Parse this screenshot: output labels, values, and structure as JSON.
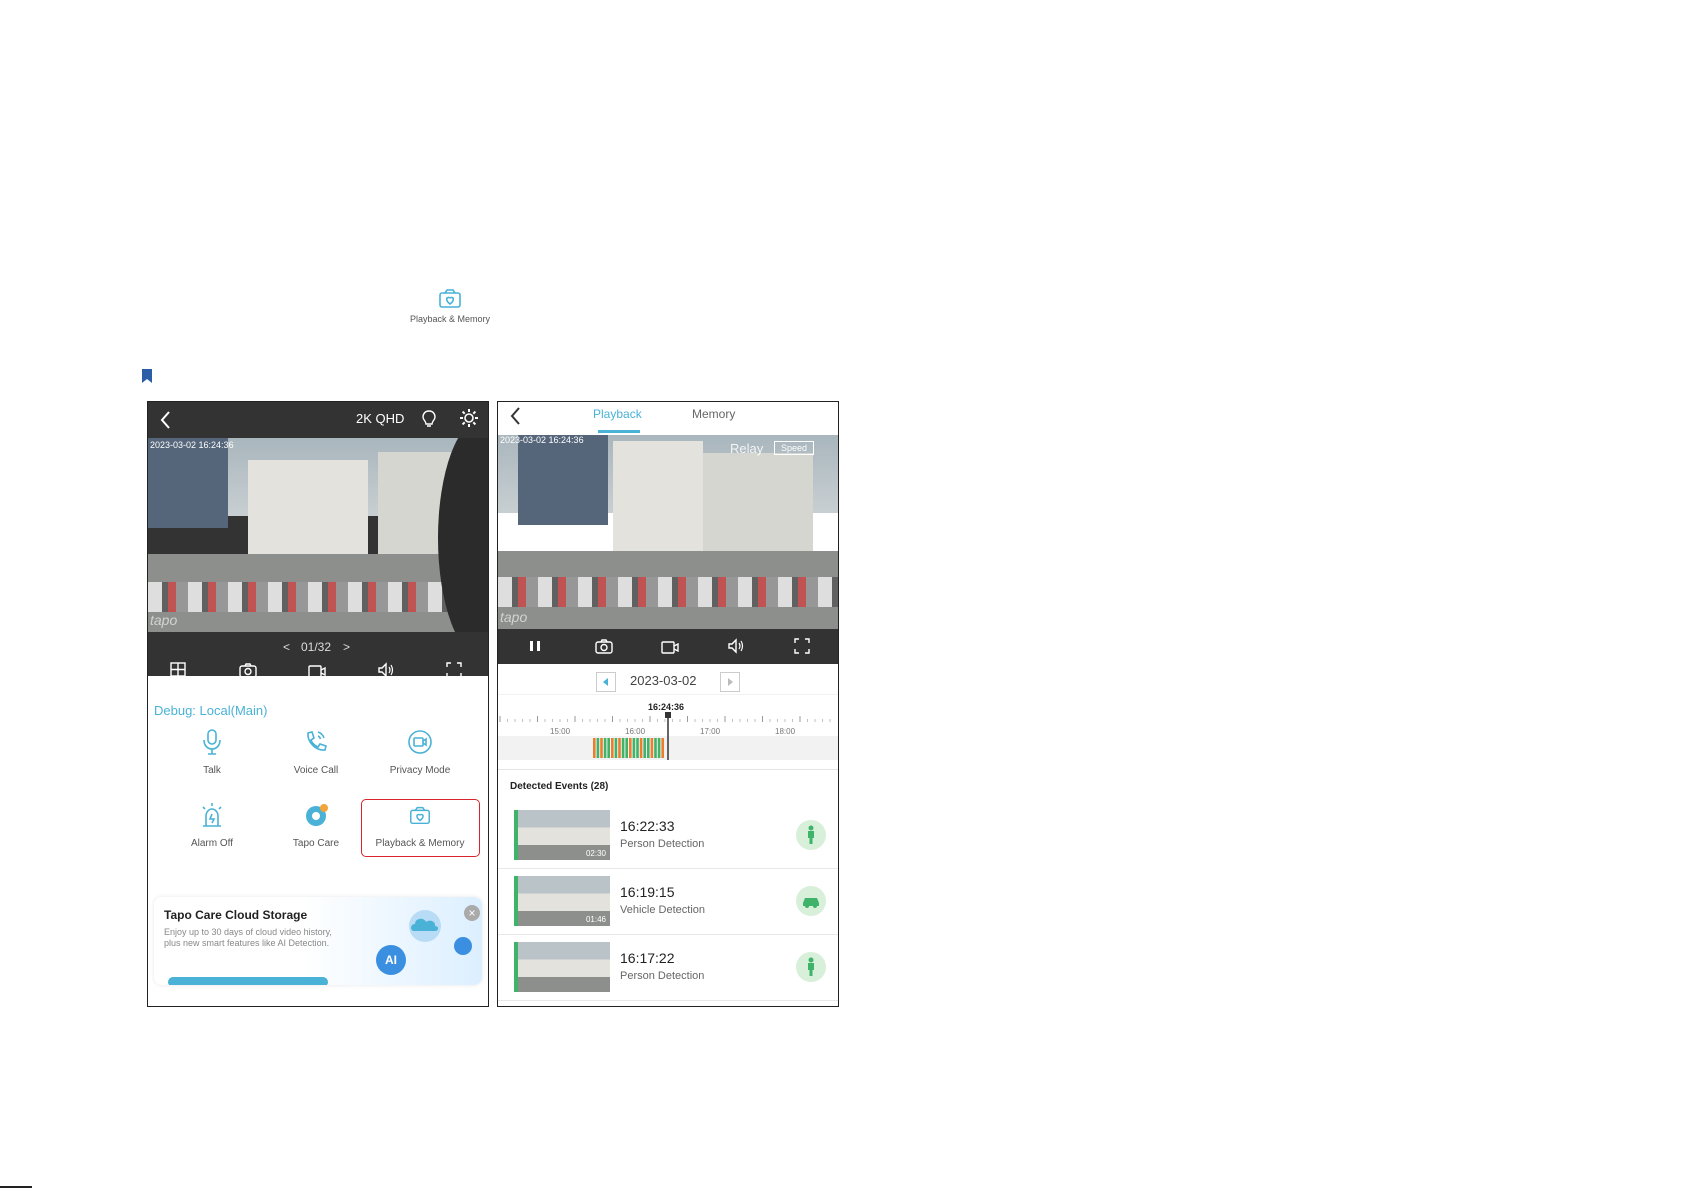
{
  "inline": {
    "label": "Playback & Memory",
    "icon": "playback-memory-icon"
  },
  "left_phone": {
    "header": {
      "quality": "2K QHD"
    },
    "video": {
      "timestamp": "2023-03-02 16:24:36",
      "watermark": "tapo"
    },
    "pager": {
      "prev": "<",
      "text": "01/32",
      "next": ">"
    },
    "toolbar_icons": [
      "grid-icon",
      "camera-icon",
      "record-icon",
      "speaker-icon",
      "fullscreen-icon"
    ],
    "debug_text": "Debug: Local(Main)",
    "actions": [
      {
        "label": "Talk",
        "icon": "microphone-icon"
      },
      {
        "label": "Voice Call",
        "icon": "phone-icon"
      },
      {
        "label": "Privacy Mode",
        "icon": "privacy-camera-icon"
      },
      {
        "label": "Alarm Off",
        "icon": "alarm-icon"
      },
      {
        "label": "Tapo Care",
        "icon": "tapo-care-icon"
      },
      {
        "label": "Playback & Memory",
        "icon": "playback-memory-icon"
      }
    ],
    "promo": {
      "title": "Tapo Care Cloud Storage",
      "body": "Enjoy up to 30 days of cloud video history, plus new smart features like AI Detection.",
      "ai_badge": "AI"
    },
    "accent": "#49b2d6",
    "highlight": "#d9242f"
  },
  "right_phone": {
    "tabs": [
      {
        "label": "Playback",
        "active": true
      },
      {
        "label": "Memory",
        "active": false
      }
    ],
    "video": {
      "timestamp": "2023-03-02 16:24:36",
      "relay": "Relay",
      "speed": "Speed",
      "watermark": "tapo"
    },
    "date": "2023-03-02",
    "timeline": {
      "cursor": "16:24:36",
      "ticks": [
        "15:00",
        "16:00",
        "17:00",
        "18:00"
      ]
    },
    "events_header": "Detected Events (28)",
    "events": [
      {
        "time": "16:22:33",
        "type": "Person Detection",
        "duration": "02:30",
        "icon": "person-icon"
      },
      {
        "time": "16:19:15",
        "type": "Vehicle Detection",
        "duration": "01:46",
        "icon": "car-icon"
      },
      {
        "time": "16:17:22",
        "type": "Person Detection",
        "duration": "",
        "icon": "person-icon"
      }
    ]
  }
}
